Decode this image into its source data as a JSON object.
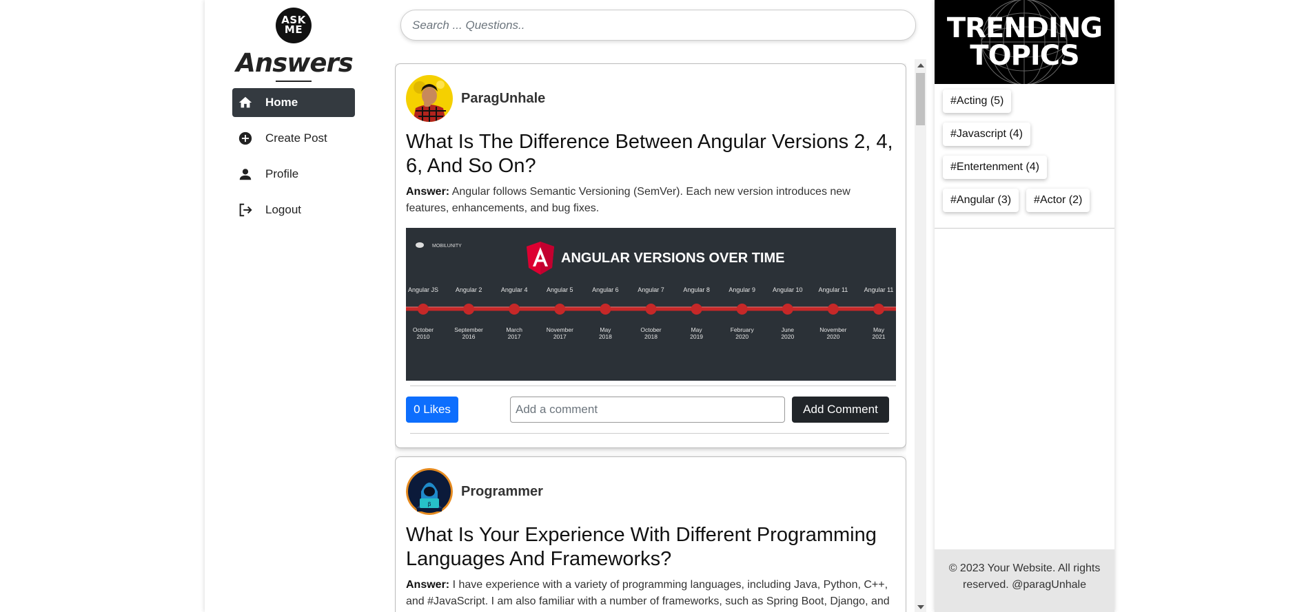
{
  "sidebar": {
    "logo_badge": "ASK ME",
    "brand": "Answers",
    "nav": [
      {
        "label": "Home",
        "icon": "home-icon",
        "active": true
      },
      {
        "label": "Create Post",
        "icon": "plus-circle-icon",
        "active": false
      },
      {
        "label": "Profile",
        "icon": "person-icon",
        "active": false
      },
      {
        "label": "Logout",
        "icon": "logout-icon",
        "active": false
      }
    ]
  },
  "search": {
    "placeholder": "Search ... Questions.."
  },
  "posts": [
    {
      "author": "ParagUnhale",
      "title": "What Is The Difference Between Angular Versions 2, 4, 6, And So On?",
      "answer_label": "Answer:",
      "answer": "Angular follows Semantic Versioning (SemVer). Each new version introduces new features, enhancements, and bug fixes.",
      "image": {
        "brand": "MOBILUNITY",
        "heading": "ANGULAR VERSIONS OVER TIME",
        "timeline": [
          {
            "version": "Angular JS",
            "date": "October 2010"
          },
          {
            "version": "Angular 2",
            "date": "September 2016"
          },
          {
            "version": "Angular 4",
            "date": "March 2017"
          },
          {
            "version": "Angular 5",
            "date": "November 2017"
          },
          {
            "version": "Angular 6",
            "date": "May 2018"
          },
          {
            "version": "Angular 7",
            "date": "October 2018"
          },
          {
            "version": "Angular 8",
            "date": "May 2019"
          },
          {
            "version": "Angular 9",
            "date": "February 2020"
          },
          {
            "version": "Angular 10",
            "date": "June 2020"
          },
          {
            "version": "Angular 11",
            "date": "November 2020"
          },
          {
            "version": "Angular 11",
            "date": "May 2021"
          }
        ]
      },
      "likes": "0 Likes",
      "comment_placeholder": "Add a comment",
      "add_comment": "Add Comment"
    },
    {
      "author": "Programmer",
      "title": "What Is Your Experience With Different Programming Languages And Frameworks?",
      "answer_label": "Answer:",
      "answer": "I have experience with a variety of programming languages, including Java, Python, C++, and #JavaScript. I am also familiar with a number of frameworks, such as Spring Boot, Django, and #React."
    }
  ],
  "trending": {
    "banner_line1": "TRENDING",
    "banner_line2": "TOPICS",
    "tags": [
      "#Acting (5)",
      "#Javascript (4)",
      "#Entertenment (4)",
      "#Angular (3)",
      "#Actor (2)"
    ]
  },
  "footer": {
    "text": "© 2023 Your Website. All rights reserved. @paragUnhale"
  },
  "colors": {
    "primary": "#0d6efd",
    "dark": "#212529",
    "nav_active": "#343a40",
    "timeline_red": "#c62828"
  }
}
